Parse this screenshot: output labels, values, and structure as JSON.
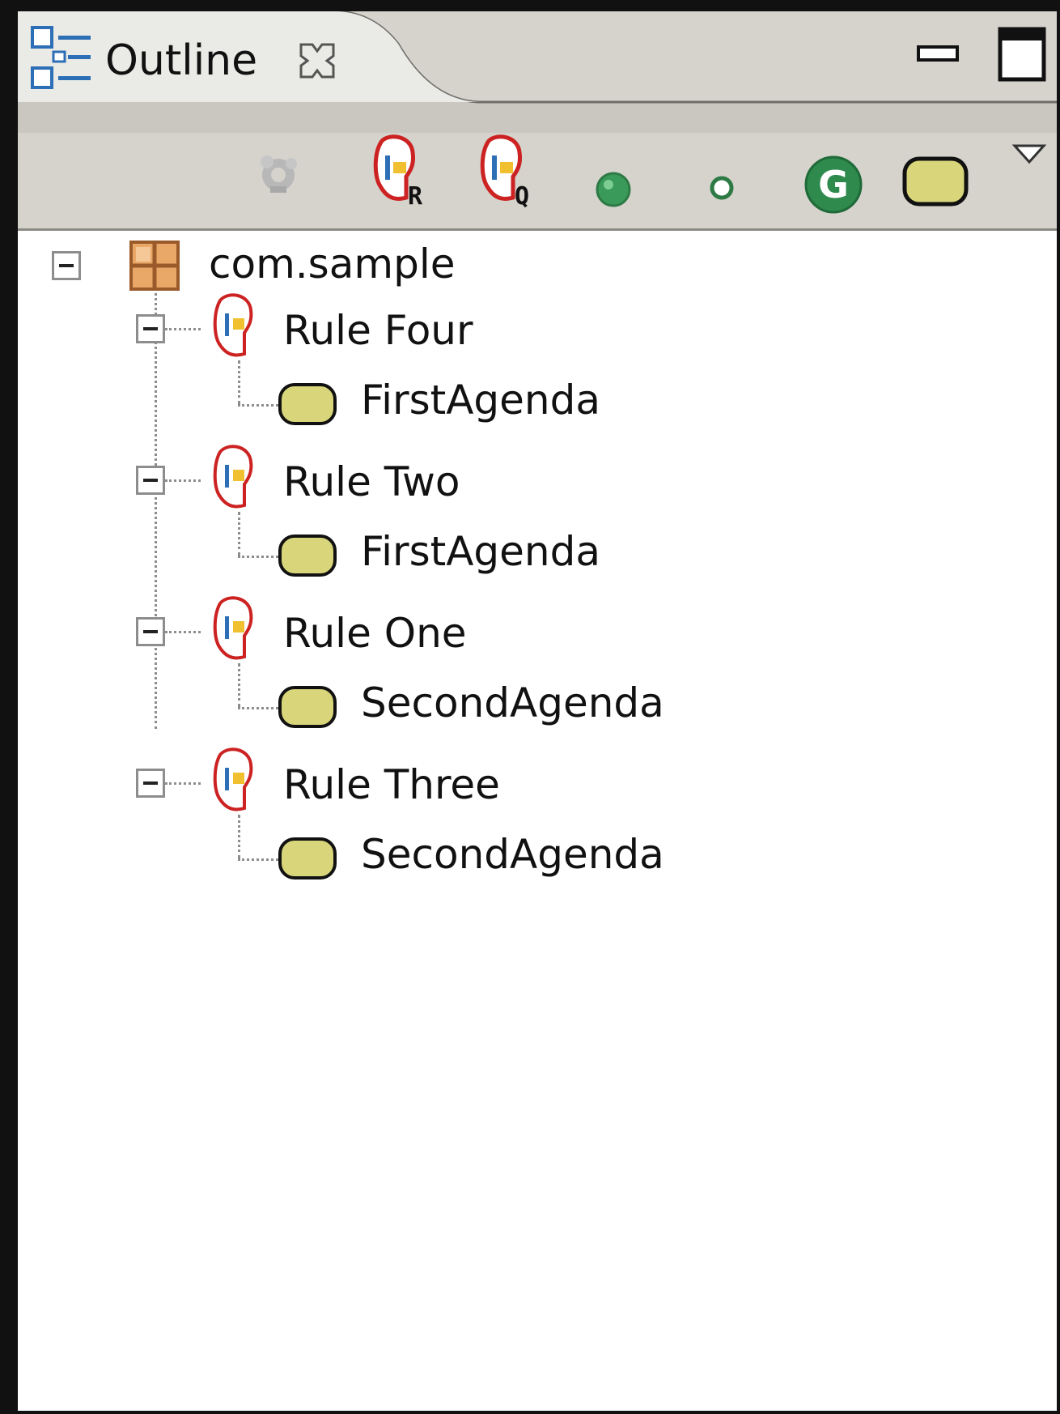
{
  "window": {
    "tab_title": "Outline",
    "view_icon": "outline-view-icon",
    "close_icon": "close-x-icon",
    "minimize_icon": "minimize-icon",
    "maximize_icon": "maximize-icon"
  },
  "toolbar": {
    "buttons": [
      {
        "name": "gear-disabled-icon",
        "enabled": false
      },
      {
        "name": "rule-r-icon",
        "badge": "R"
      },
      {
        "name": "rule-q-icon",
        "badge": "Q"
      },
      {
        "name": "green-dot-icon"
      },
      {
        "name": "small-green-dot-icon"
      },
      {
        "name": "green-g-icon",
        "badge": "G"
      },
      {
        "name": "agenda-group-icon"
      },
      {
        "name": "view-menu-chevron-icon"
      }
    ]
  },
  "tree": {
    "package": {
      "label": "com.sample",
      "icon": "package-icon"
    },
    "rules": [
      {
        "label": "Rule Four",
        "icon": "rule-icon",
        "agenda": "FirstAgenda"
      },
      {
        "label": "Rule Two",
        "icon": "rule-icon",
        "agenda": "FirstAgenda"
      },
      {
        "label": "Rule One",
        "icon": "rule-icon",
        "agenda": "SecondAgenda"
      },
      {
        "label": "Rule Three",
        "icon": "rule-icon",
        "agenda": "SecondAgenda"
      }
    ]
  },
  "colors": {
    "chrome": "#d5d3cc",
    "agenda_fill": "#d8d57a",
    "rule_outline": "#cc2222",
    "green": "#3a9a5a"
  }
}
